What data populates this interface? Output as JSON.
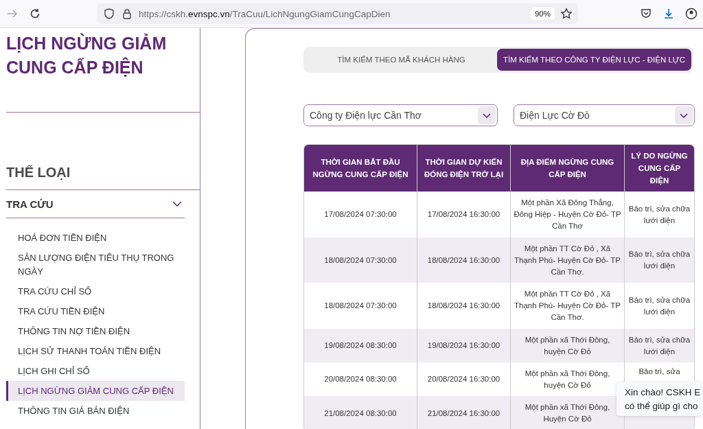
{
  "browser": {
    "url": "https://cskh.**evnspc.vn**/TraCuu/LichNgungGiamCungCapDien",
    "zoom": "90%"
  },
  "sidebar": {
    "title": "LỊCH NGỪNG GIẢM CUNG CẤP ĐIỆN",
    "category_heading": "THỂ LOẠI",
    "group": {
      "label": "TRA CỨU",
      "expanded": true
    },
    "items": [
      {
        "label": "HOÁ ĐƠN TIỀN ĐIỆN",
        "selected": false
      },
      {
        "label": "SẢN LƯỢNG ĐIỆN TIÊU THỤ TRONG NGÀY",
        "selected": false
      },
      {
        "label": "TRA CỨU CHỈ SỐ",
        "selected": false
      },
      {
        "label": "TRA CỨU TIỀN ĐIỆN",
        "selected": false
      },
      {
        "label": "THÔNG TIN NỢ TIỀN ĐIỆN",
        "selected": false
      },
      {
        "label": "LỊCH SỬ THANH TOÁN TIỀN ĐIỆN",
        "selected": false
      },
      {
        "label": "LỊCH GHI CHỈ SỐ",
        "selected": false
      },
      {
        "label": "LỊCH NGỪNG GIẢM CUNG CẤP ĐIỆN",
        "selected": true
      },
      {
        "label": "THÔNG TIN GIÁ BÁN ĐIỆN",
        "selected": false
      }
    ]
  },
  "tabs": [
    {
      "label": "TÌM KIẾM THEO MÃ KHÁCH HÀNG",
      "selected": false
    },
    {
      "label": "TÌM KIẾM THEO CÔNG TY ĐIỆN LỰC - ĐIỆN LỰC",
      "selected": true
    }
  ],
  "filters": [
    {
      "value": "Công ty Điện lực Cần Thơ"
    },
    {
      "value": "Điện Lực Cờ Đỏ"
    }
  ],
  "table": {
    "columns": [
      "THỜI GIAN BẮT ĐẦU NGỪNG CUNG CẤP ĐIỆN",
      "THỜI GIAN DỰ KIẾN ĐÓNG ĐIỆN TRỞ LẠI",
      "ĐỊA ĐIỂM NGỪNG CUNG CẤP ĐIỆN",
      "LÝ DO NGỪNG CUNG CẤP ĐIỆN"
    ],
    "rows": [
      [
        "17/08/2024 07:30:00",
        "17/08/2024 16:30:00",
        "Một phần Xã Đông Thắng, Đông Hiệp - Huyện Cờ Đỏ- TP Cần Thơ",
        "Bảo trì, sửa chữa lưới điện"
      ],
      [
        "18/08/2024 07:30:00",
        "18/08/2024 16:30:00",
        "Một phần TT Cờ Đỏ , Xã Thạnh Phú- Huyện Cờ Đỏ- TP Cần Thơ.",
        "Bảo trì, sửa chữa lưới điện"
      ],
      [
        "18/08/2024 07:30:00",
        "18/08/2024 16:30:00",
        "Một phần TT Cờ Đỏ , Xã Thạnh Phú- Huyện Cờ Đỏ- TP Cần Thơ.",
        "Bảo trì, sửa chữa lưới điện"
      ],
      [
        "19/08/2024 08:30:00",
        "19/08/2024 16:30:00",
        "Một phần xã Thới Đông, huyện Cờ Đỏ",
        "Bảo trì, sửa chữa lưới điện"
      ],
      [
        "20/08/2024 08:30:00",
        "20/08/2024 16:30:00",
        "Một phần xã Thới Đông, huyện Cờ Đỏ",
        "Bảo trì, sửa"
      ],
      [
        "21/08/2024 08:30:00",
        "21/08/2024 16:30:00",
        "Một phần xã Thới Đông, Huyện Cờ Đỏ"
      ]
    ]
  },
  "chat_bubble": {
    "lines": [
      "Xin chào! CSKH E",
      "có thể giúp gì cho"
    ]
  }
}
